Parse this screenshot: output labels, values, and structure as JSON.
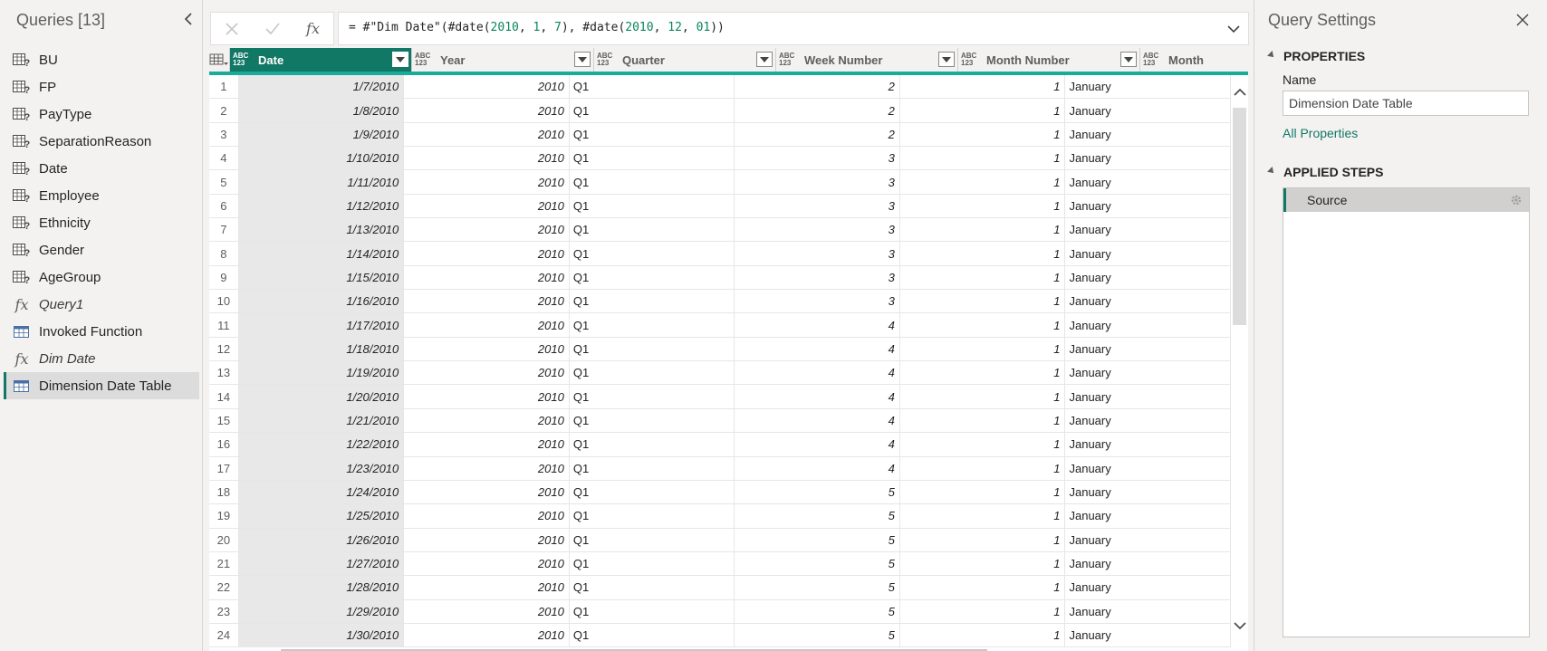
{
  "query_pane": {
    "title": "Queries [13]",
    "items": [
      {
        "label": "BU",
        "kind": "table-query",
        "italic": false,
        "active": false
      },
      {
        "label": "FP",
        "kind": "table-query",
        "italic": false,
        "active": false
      },
      {
        "label": "PayType",
        "kind": "table-query",
        "italic": false,
        "active": false
      },
      {
        "label": "SeparationReason",
        "kind": "table-query",
        "italic": false,
        "active": false
      },
      {
        "label": "Date",
        "kind": "table-query",
        "italic": false,
        "active": false
      },
      {
        "label": "Employee",
        "kind": "table-query",
        "italic": false,
        "active": false
      },
      {
        "label": "Ethnicity",
        "kind": "table-query",
        "italic": false,
        "active": false
      },
      {
        "label": "Gender",
        "kind": "table-query",
        "italic": false,
        "active": false
      },
      {
        "label": "AgeGroup",
        "kind": "table-query",
        "italic": false,
        "active": false
      },
      {
        "label": "Query1",
        "kind": "function",
        "italic": true,
        "active": false
      },
      {
        "label": "Invoked Function",
        "kind": "table",
        "italic": false,
        "active": false
      },
      {
        "label": "Dim Date",
        "kind": "function",
        "italic": true,
        "active": false
      },
      {
        "label": "Dimension Date Table",
        "kind": "table",
        "italic": false,
        "active": true
      }
    ]
  },
  "formula_bar": {
    "fx_label": "fx",
    "tokens": [
      {
        "t": "= #\"Dim Date\"(#date(",
        "num": false
      },
      {
        "t": "2010",
        "num": true
      },
      {
        "t": ", ",
        "num": false
      },
      {
        "t": "1",
        "num": true
      },
      {
        "t": ", ",
        "num": false
      },
      {
        "t": "7",
        "num": true
      },
      {
        "t": "), #date(",
        "num": false
      },
      {
        "t": "2010",
        "num": true
      },
      {
        "t": ", ",
        "num": false
      },
      {
        "t": "12",
        "num": true
      },
      {
        "t": ", ",
        "num": false
      },
      {
        "t": "01",
        "num": true
      },
      {
        "t": "))",
        "num": false
      }
    ]
  },
  "grid": {
    "type_badge": [
      "ABC",
      "123"
    ],
    "columns": [
      "Date",
      "Year",
      "Quarter",
      "Week Number",
      "Month Number",
      "Month"
    ],
    "selected_column": "Date",
    "rows": [
      [
        "1",
        "1/7/2010",
        "2010",
        "Q1",
        "2",
        "1",
        "January"
      ],
      [
        "2",
        "1/8/2010",
        "2010",
        "Q1",
        "2",
        "1",
        "January"
      ],
      [
        "3",
        "1/9/2010",
        "2010",
        "Q1",
        "2",
        "1",
        "January"
      ],
      [
        "4",
        "1/10/2010",
        "2010",
        "Q1",
        "3",
        "1",
        "January"
      ],
      [
        "5",
        "1/11/2010",
        "2010",
        "Q1",
        "3",
        "1",
        "January"
      ],
      [
        "6",
        "1/12/2010",
        "2010",
        "Q1",
        "3",
        "1",
        "January"
      ],
      [
        "7",
        "1/13/2010",
        "2010",
        "Q1",
        "3",
        "1",
        "January"
      ],
      [
        "8",
        "1/14/2010",
        "2010",
        "Q1",
        "3",
        "1",
        "January"
      ],
      [
        "9",
        "1/15/2010",
        "2010",
        "Q1",
        "3",
        "1",
        "January"
      ],
      [
        "10",
        "1/16/2010",
        "2010",
        "Q1",
        "3",
        "1",
        "January"
      ],
      [
        "11",
        "1/17/2010",
        "2010",
        "Q1",
        "4",
        "1",
        "January"
      ],
      [
        "12",
        "1/18/2010",
        "2010",
        "Q1",
        "4",
        "1",
        "January"
      ],
      [
        "13",
        "1/19/2010",
        "2010",
        "Q1",
        "4",
        "1",
        "January"
      ],
      [
        "14",
        "1/20/2010",
        "2010",
        "Q1",
        "4",
        "1",
        "January"
      ],
      [
        "15",
        "1/21/2010",
        "2010",
        "Q1",
        "4",
        "1",
        "January"
      ],
      [
        "16",
        "1/22/2010",
        "2010",
        "Q1",
        "4",
        "1",
        "January"
      ],
      [
        "17",
        "1/23/2010",
        "2010",
        "Q1",
        "4",
        "1",
        "January"
      ],
      [
        "18",
        "1/24/2010",
        "2010",
        "Q1",
        "5",
        "1",
        "January"
      ],
      [
        "19",
        "1/25/2010",
        "2010",
        "Q1",
        "5",
        "1",
        "January"
      ],
      [
        "20",
        "1/26/2010",
        "2010",
        "Q1",
        "5",
        "1",
        "January"
      ],
      [
        "21",
        "1/27/2010",
        "2010",
        "Q1",
        "5",
        "1",
        "January"
      ],
      [
        "22",
        "1/28/2010",
        "2010",
        "Q1",
        "5",
        "1",
        "January"
      ],
      [
        "23",
        "1/29/2010",
        "2010",
        "Q1",
        "5",
        "1",
        "January"
      ],
      [
        "24",
        "1/30/2010",
        "2010",
        "Q1",
        "5",
        "1",
        "January"
      ]
    ]
  },
  "settings": {
    "title": "Query Settings",
    "properties_heading": "PROPERTIES",
    "name_label": "Name",
    "name_value": "Dimension Date Table",
    "all_properties_link": "All Properties",
    "applied_steps_heading": "APPLIED STEPS",
    "steps": [
      "Source"
    ]
  },
  "colors": {
    "accent": "#117865",
    "header_underline": "#1aab9b",
    "number_literal": "#098658"
  }
}
